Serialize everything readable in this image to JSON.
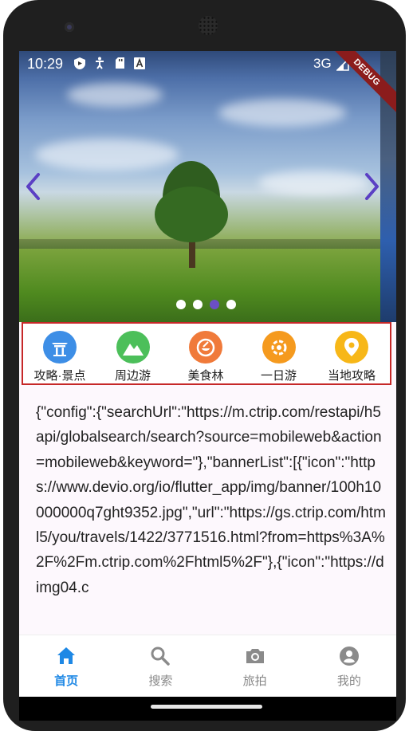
{
  "status": {
    "time": "10:29",
    "network": "3G",
    "debug_banner": "DEBUG"
  },
  "banner": {
    "slide_count": 4,
    "active_slide": 3
  },
  "grid_nav": {
    "items": [
      {
        "label": "攻略·景点",
        "icon": "temple-icon",
        "color": "#3d8ee6"
      },
      {
        "label": "周边游",
        "icon": "mountain-icon",
        "color": "#4cbf5a"
      },
      {
        "label": "美食林",
        "icon": "food-icon",
        "color": "#f07a3a"
      },
      {
        "label": "一日游",
        "icon": "ring-icon",
        "color": "#f59a1e"
      },
      {
        "label": "当地攻略",
        "icon": "location-icon",
        "color": "#f7b718"
      }
    ]
  },
  "content": {
    "json_text": "{\"config\":{\"searchUrl\":\"https://m.ctrip.com/restapi/h5api/globalsearch/search?source=mobileweb&action=mobileweb&keyword=\"},\"bannerList\":[{\"icon\":\"https://www.devio.org/io/flutter_app/img/banner/100h10000000q7ght9352.jpg\",\"url\":\"https://gs.ctrip.com/html5/you/travels/1422/3771516.html?from=https%3A%2F%2Fm.ctrip.com%2Fhtml5%2F\"},{\"icon\":\"https://dimg04.c"
  },
  "tabbar": {
    "tabs": [
      {
        "label": "首页",
        "icon": "home-icon",
        "active": true
      },
      {
        "label": "搜索",
        "icon": "search-icon",
        "active": false
      },
      {
        "label": "旅拍",
        "icon": "camera-icon",
        "active": false
      },
      {
        "label": "我的",
        "icon": "account-icon",
        "active": false
      }
    ]
  },
  "colors": {
    "active_tab": "#1e88e5",
    "inactive_tab": "#888888",
    "active_dot": "#6b4fc4",
    "grid_border": "#c62828"
  }
}
